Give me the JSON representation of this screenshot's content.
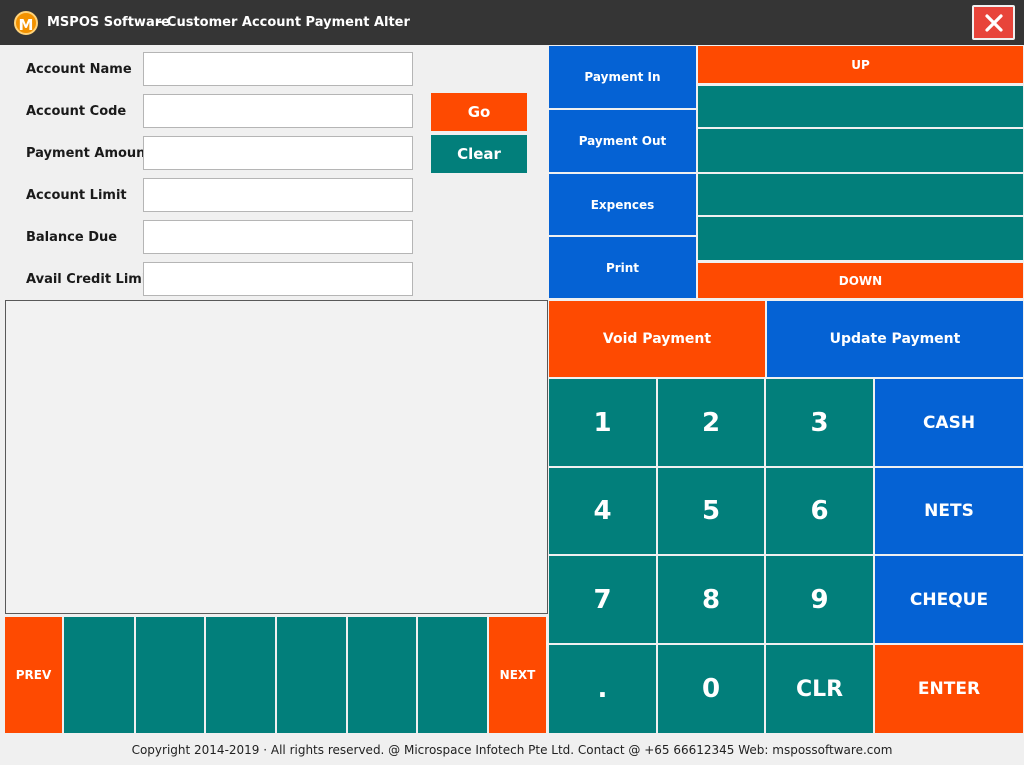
{
  "window": {
    "logo_letter": "M",
    "app_name": "MSPOS Software",
    "page_title": "- Customer Account Payment Alter"
  },
  "form": {
    "fields": [
      {
        "label": "Account Name",
        "value": ""
      },
      {
        "label": "Account Code",
        "value": ""
      },
      {
        "label": "Payment Amount",
        "value": ""
      },
      {
        "label": "Account Limit",
        "value": ""
      },
      {
        "label": "Balance Due",
        "value": ""
      },
      {
        "label": "Avail Credit Limit",
        "value": ""
      }
    ],
    "go_label": "Go",
    "clear_label": "Clear"
  },
  "menu": {
    "items": [
      "Payment In",
      "Payment Out",
      "Expences",
      "Print"
    ]
  },
  "scroll": {
    "up_label": "UP",
    "down_label": "DOWN"
  },
  "actions": {
    "void_label": "Void Payment",
    "update_label": "Update Payment"
  },
  "keypad": {
    "k1": "1",
    "k2": "2",
    "k3": "3",
    "k4": "4",
    "k5": "5",
    "k6": "6",
    "k7": "7",
    "k8": "8",
    "k9": "9",
    "kdot": ".",
    "k0": "0",
    "kclr": "CLR"
  },
  "tender": {
    "cash": "CASH",
    "nets": "NETS",
    "cheque": "CHEQUE",
    "enter": "ENTER"
  },
  "pager": {
    "prev": "PREV",
    "next": "NEXT"
  },
  "footer": {
    "text": "Copyright 2014-2019 · All rights reserved. @ Microspace Infotech Pte Ltd.  Contact @ +65 66612345 Web: mspossoftware.com"
  },
  "colors": {
    "orange": "#fe4a01",
    "teal": "#027f7b",
    "blue": "#0562d4",
    "titlebar": "#353535"
  }
}
